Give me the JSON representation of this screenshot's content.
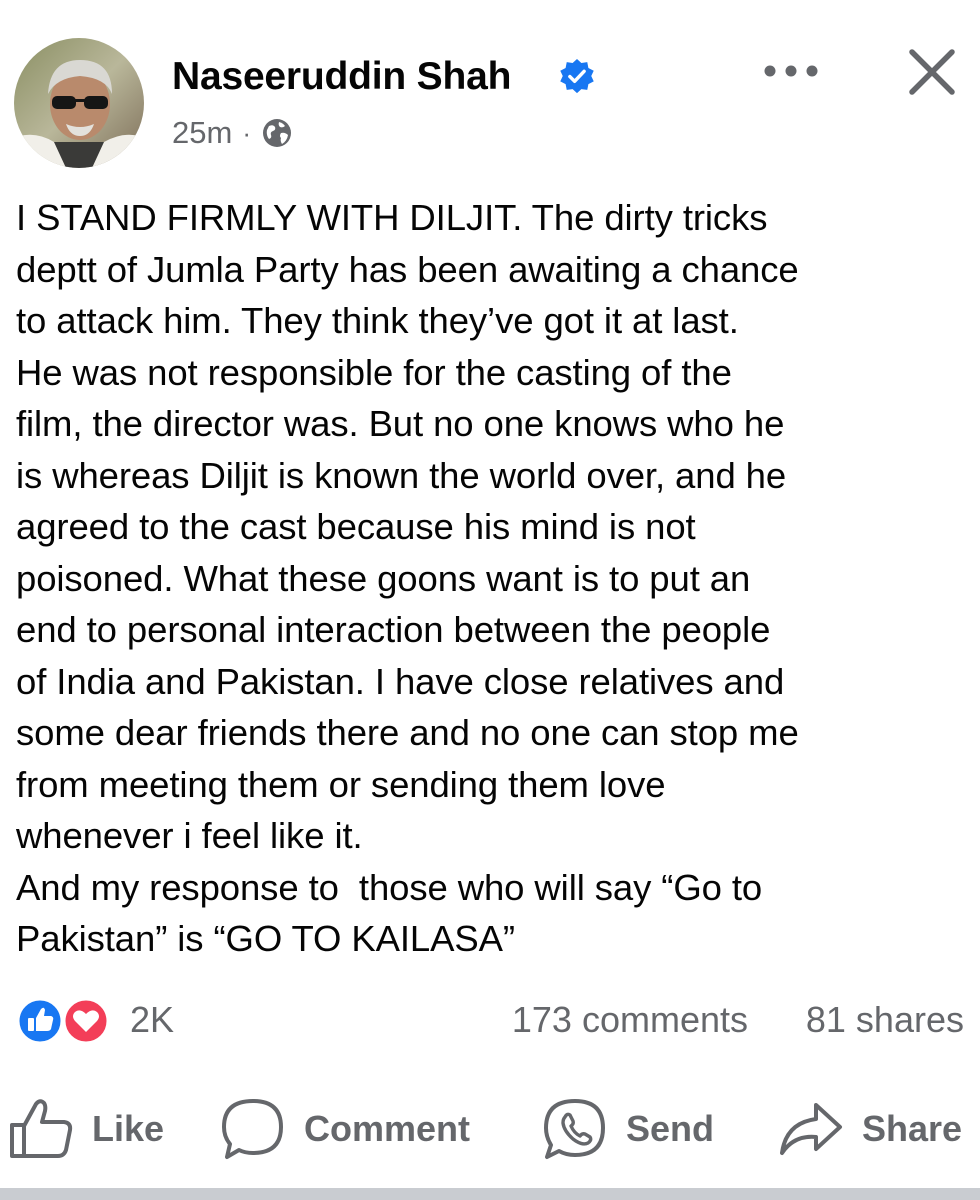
{
  "post": {
    "author": "Naseeruddin Shah",
    "timestamp": "25m",
    "separator": "·",
    "audience_icon": "globe-icon",
    "verified_icon": "verified-badge-icon",
    "body": "I STAND FIRMLY WITH DILJIT. The dirty tricks\ndeptt of Jumla Party has been awaiting a chance\nto attack him. They think they’ve got it at last.\nHe was not responsible for the casting of the\nfilm, the director was. But no one knows who he\nis whereas Diljit is known the world over, and he\nagreed to the cast because his mind is not\npoisoned. What these goons want is to put an\nend to personal interaction between the people\nof India and Pakistan. I have close relatives and\nsome dear friends there and no one can stop me\nfrom meeting them or sending them love\nwhenever i feel like it.\nAnd my response to  those who will say “Go to\nPakistan” is “GO TO KAILASA”"
  },
  "stats": {
    "reactions_count": "2K",
    "comments": "173 comments",
    "shares": "81 shares",
    "reaction_icons": [
      "like-reaction-icon",
      "love-reaction-icon"
    ]
  },
  "actions": {
    "like": "Like",
    "comment": "Comment",
    "send": "Send",
    "share": "Share"
  },
  "colors": {
    "facebook_blue": "#1877f2",
    "love_red": "#f33e58",
    "secondary_text": "#65676b",
    "primary_text": "#050505"
  }
}
